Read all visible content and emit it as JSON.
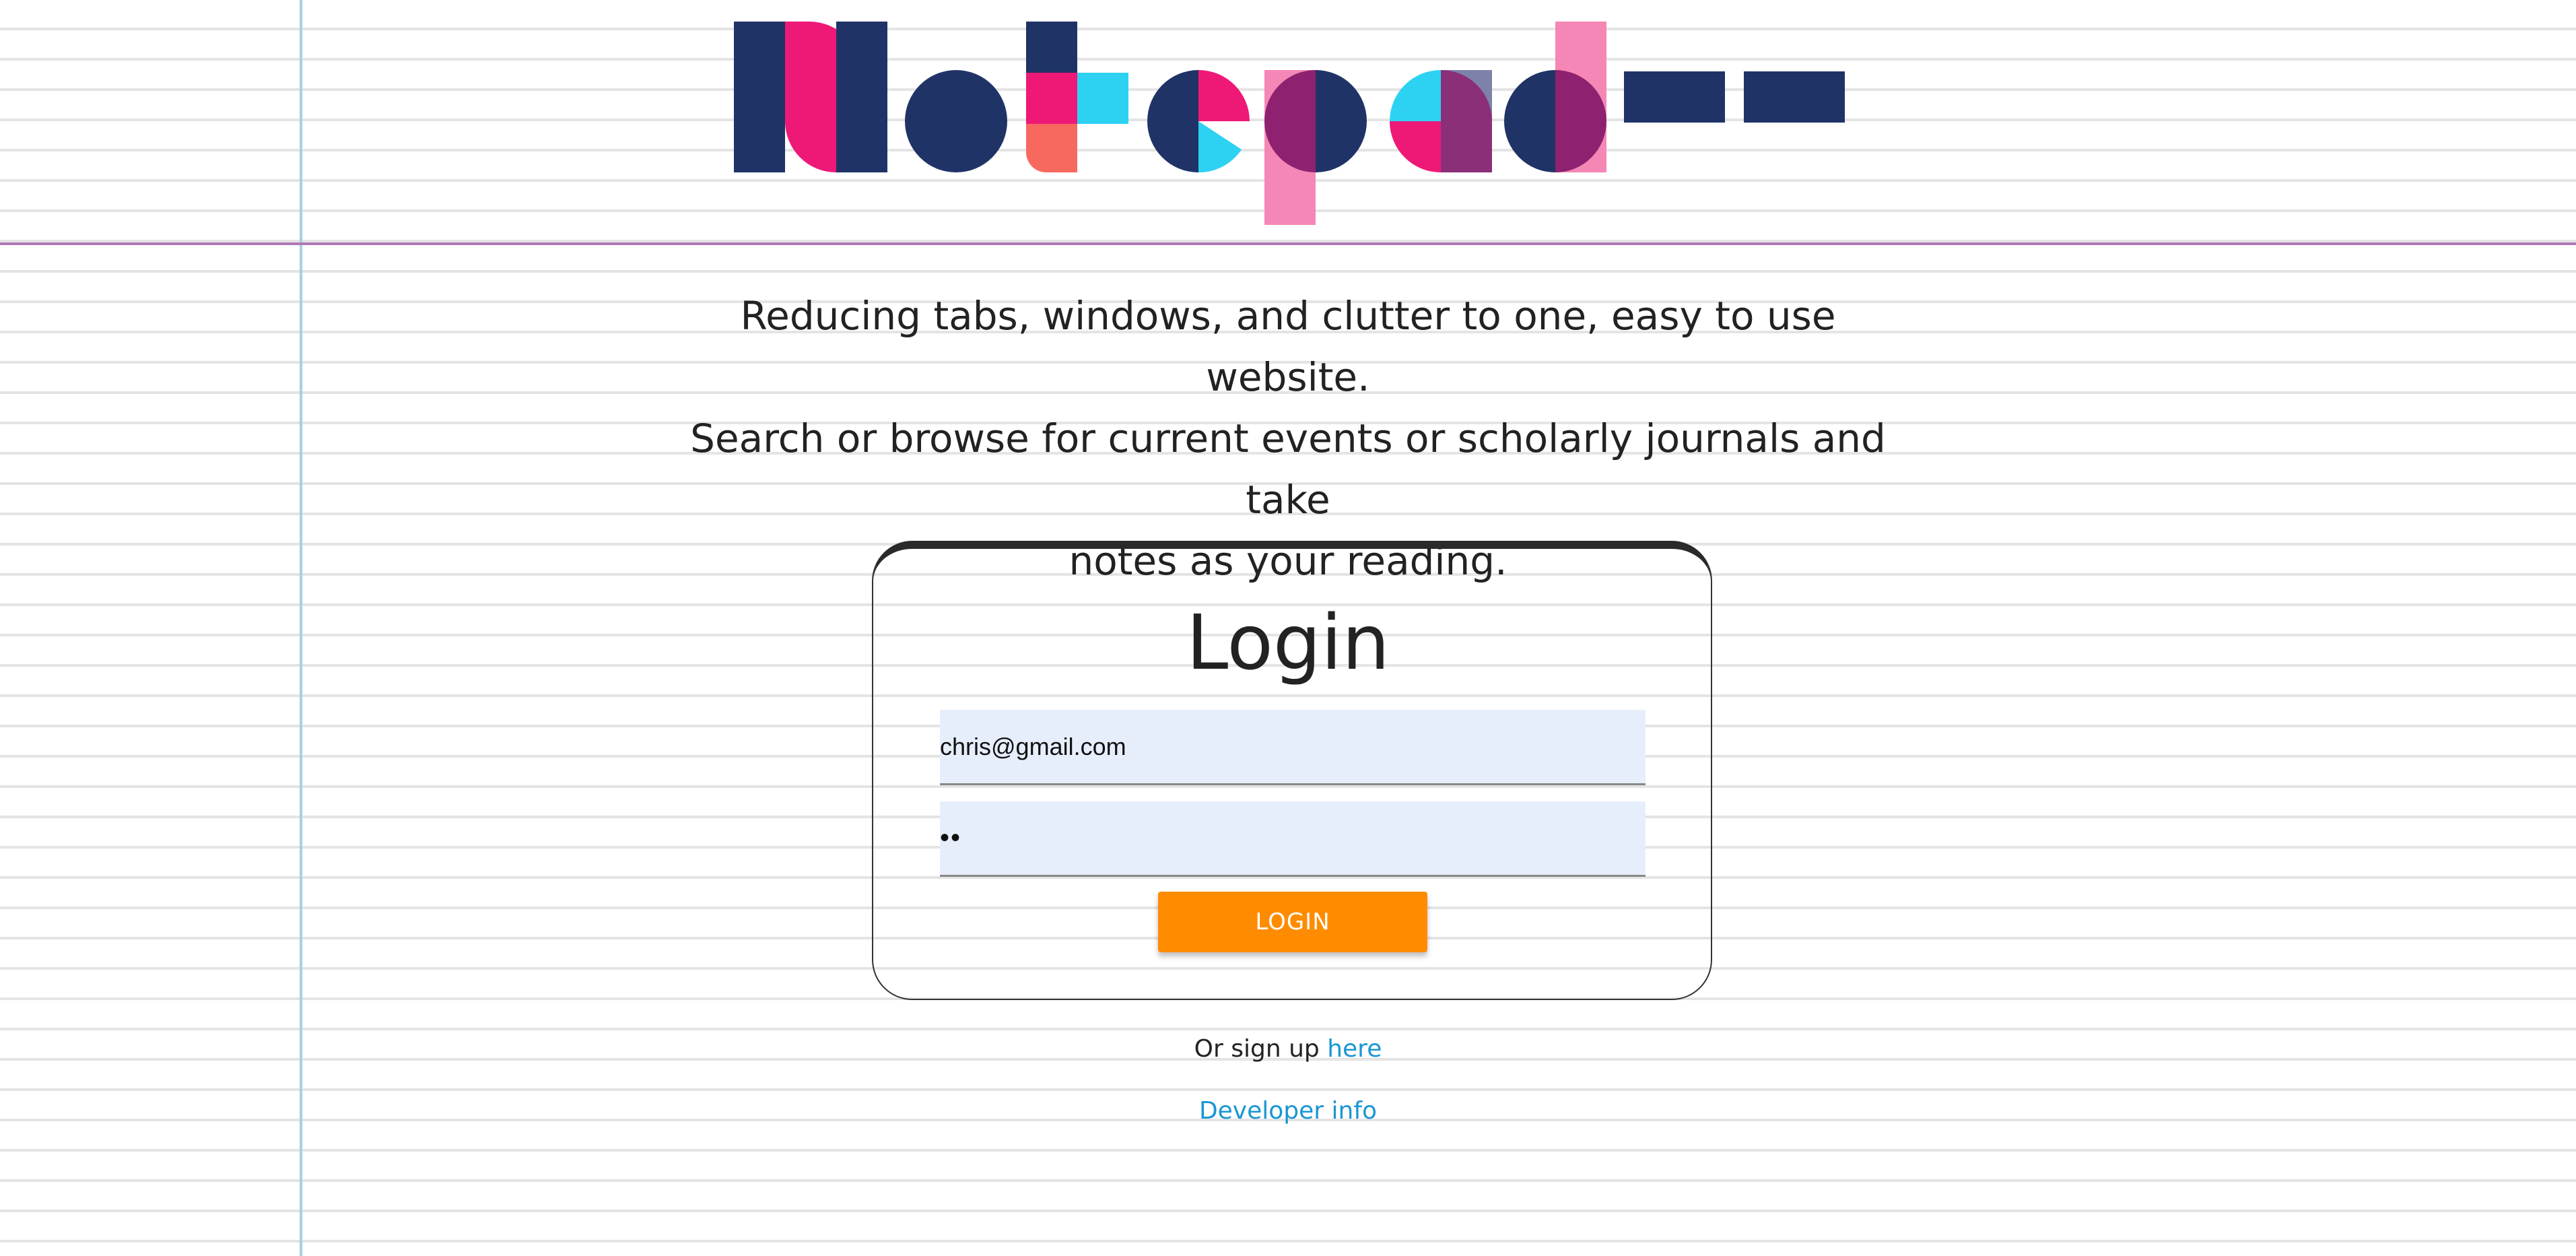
{
  "app": {
    "logo_text": "Notepad++",
    "colors": {
      "navy": "#1f3366",
      "pink": "#ee1877",
      "light_pink": "#f587b6",
      "cyan": "#2dd2f2",
      "coral": "#f7685f",
      "purple": "#8e2170",
      "slate": "#7c82a8",
      "accent_orange": "#ff8c00",
      "link_blue": "#1a96d4"
    }
  },
  "tagline": {
    "line1": "Reducing tabs, windows, and clutter to one, easy to use website.",
    "line2": "Search or browse for current events or scholarly journals and take",
    "line3": "notes as your reading."
  },
  "login": {
    "title": "Login",
    "email_value": "chris@gmail.com",
    "password_value": "••",
    "button_label": "LOGIN"
  },
  "footer": {
    "signup_prefix": "Or sign up ",
    "signup_link": "here",
    "developer_link": "Developer info"
  }
}
